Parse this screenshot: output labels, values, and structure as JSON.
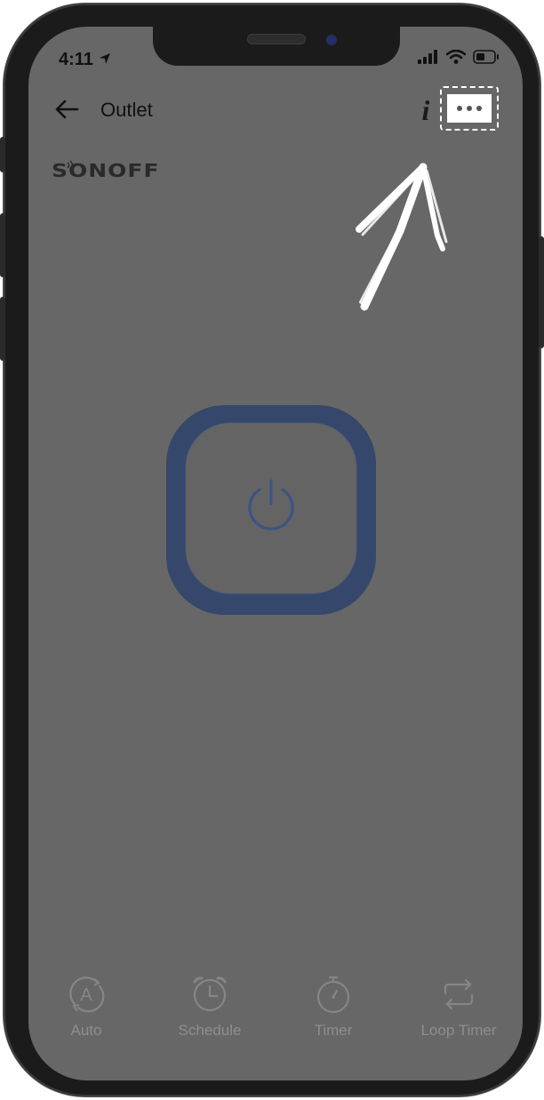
{
  "status_bar": {
    "time": "4:11",
    "icons": [
      "location-arrow-icon",
      "cellular-signal-icon",
      "wifi-icon",
      "battery-icon"
    ]
  },
  "header": {
    "title": "Outlet",
    "back_icon": "arrow-left-icon",
    "info_label": "i",
    "more_icon": "more-dots-icon"
  },
  "brand": {
    "logo_text": "SONOFF"
  },
  "main": {
    "power_icon": "power-icon",
    "accent_color": "#35476b"
  },
  "bottom_tabs": [
    {
      "label": "Auto",
      "icon": "auto-icon"
    },
    {
      "label": "Schedule",
      "icon": "alarm-clock-icon"
    },
    {
      "label": "Timer",
      "icon": "stopwatch-icon"
    },
    {
      "label": "Loop Timer",
      "icon": "loop-icon"
    }
  ]
}
